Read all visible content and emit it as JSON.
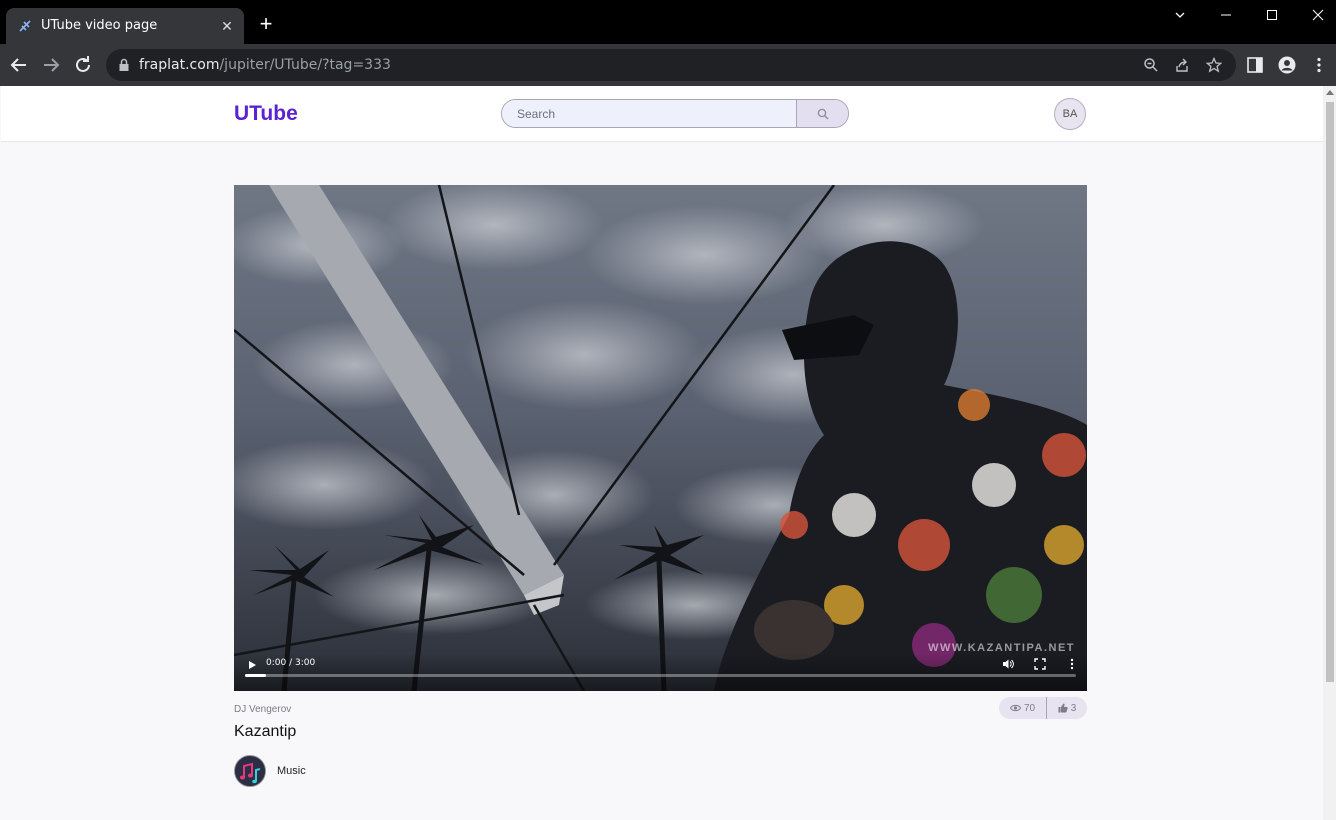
{
  "browser": {
    "tab_title": "UTube video page",
    "new_tab_label": "+",
    "url_host": "fraplat.com",
    "url_path": "/jupiter/UTube/?tag=333"
  },
  "header": {
    "logo": "UTube",
    "search_placeholder": "Search",
    "avatar_initials": "BA"
  },
  "video": {
    "time_display": "0:00 / 3:00",
    "watermark": "WWW.KAZANTIPA.NET",
    "progress_fraction": 0.025
  },
  "details": {
    "author": "DJ Vengerov",
    "title": "Kazantip",
    "views": "70",
    "likes": "3",
    "channel_name": "Music"
  },
  "colors": {
    "brand": "#5b22cf",
    "chip_bg": "#e7e3f1"
  }
}
